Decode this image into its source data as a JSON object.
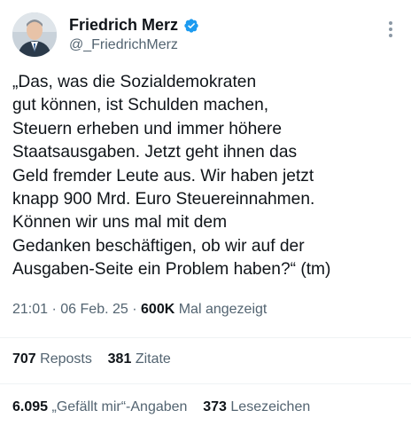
{
  "author": {
    "name": "Friedrich Merz",
    "handle": "@_FriedrichMerz",
    "verified_color": "#1d9bf0"
  },
  "tweet": {
    "lines": [
      "„Das, was die Sozialdemokraten",
      "gut können, ist Schulden machen,",
      "Steuern erheben und immer höhere",
      "Staatsausgaben. Jetzt geht ihnen das",
      "Geld fremder Leute aus. Wir haben jetzt",
      "knapp 900 Mrd. Euro Steuereinnahmen.",
      "Können wir uns mal mit dem",
      "Gedanken beschäftigen, ob wir auf der",
      "Ausgaben-Seite ein Problem haben?“ (tm)"
    ]
  },
  "meta": {
    "time": "21:01",
    "sep1": "·",
    "date": "06 Feb. 25",
    "sep2": "·",
    "views_count": "600K",
    "views_label": "Mal angezeigt"
  },
  "stats": {
    "reposts_count": "707",
    "reposts_label": "Reposts",
    "quotes_count": "381",
    "quotes_label": "Zitate",
    "likes_count": "6.095",
    "likes_label": "„Gefällt mir“-Angaben",
    "bookmarks_count": "373",
    "bookmarks_label": "Lesezeichen"
  },
  "icons": {
    "verified": "verified-badge-icon",
    "more": "more-options-icon"
  }
}
